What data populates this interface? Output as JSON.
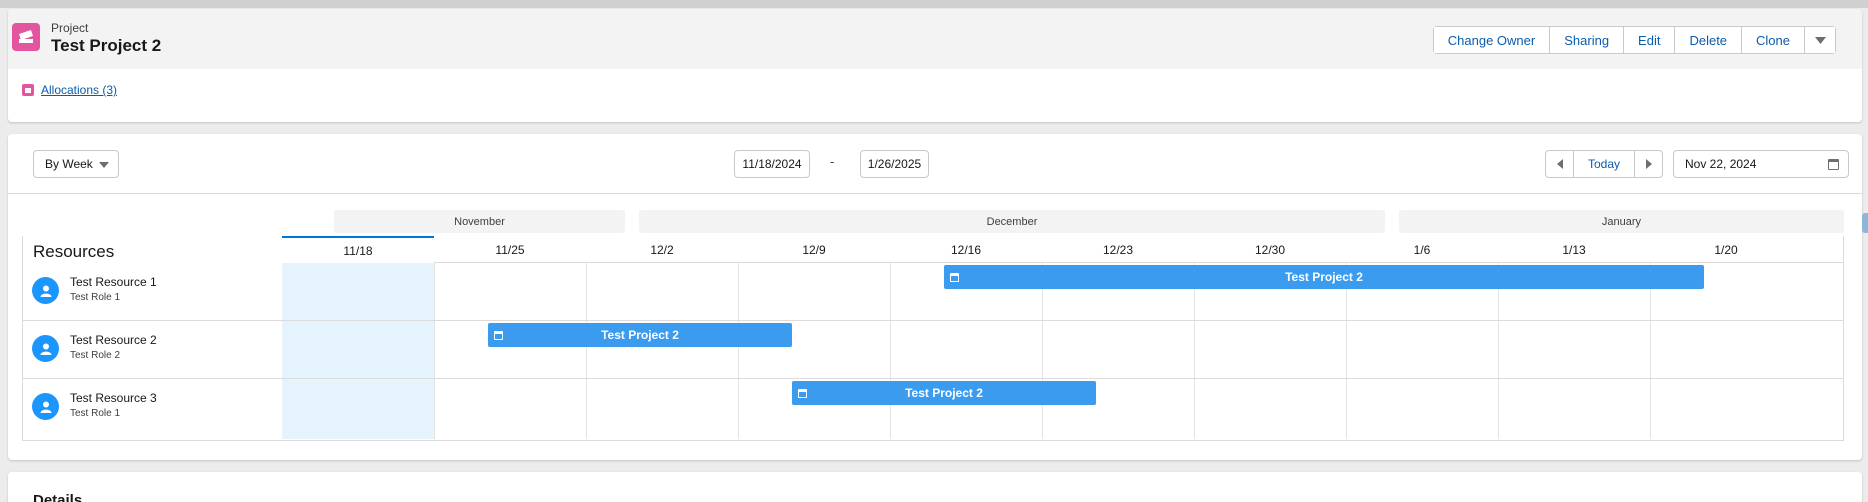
{
  "header": {
    "object_type": "Project",
    "record_name": "Test Project 2",
    "actions": [
      "Change Owner",
      "Sharing",
      "Edit",
      "Delete",
      "Clone"
    ],
    "related_link": "Allocations (3)",
    "icon": "project-icon",
    "icon_color": "#e3559e"
  },
  "toolbar": {
    "view": "By Week",
    "start_date": "11/18/2024",
    "separator": "-",
    "end_date": "1/26/2025",
    "today_label": "Today",
    "current_date": "Nov 22, 2024"
  },
  "timeline": {
    "resources_title": "Resources",
    "months": [
      "November",
      "December",
      "January"
    ],
    "weeks": [
      "11/18",
      "11/25",
      "12/2",
      "12/9",
      "12/16",
      "12/23",
      "12/30",
      "1/6",
      "1/13",
      "1/20"
    ],
    "current_week": "11/18",
    "bar_color": "#3a9bef",
    "resources": [
      {
        "name": "Test Resource 1",
        "role": "Test Role 1"
      },
      {
        "name": "Test Resource 2",
        "role": "Test Role 2"
      },
      {
        "name": "Test Resource 3",
        "role": "Test Role 1"
      }
    ],
    "allocations": [
      {
        "resource": "Test Resource 1",
        "label": "Test Project 2",
        "start_week": "12/16",
        "end_week": "1/13"
      },
      {
        "resource": "Test Resource 2",
        "label": "Test Project 2",
        "start_week": "11/25",
        "end_week": "12/2"
      },
      {
        "resource": "Test Resource 3",
        "label": "Test Project 2",
        "start_week": "12/9",
        "end_week": "12/16"
      }
    ]
  },
  "details": {
    "title": "Details"
  }
}
